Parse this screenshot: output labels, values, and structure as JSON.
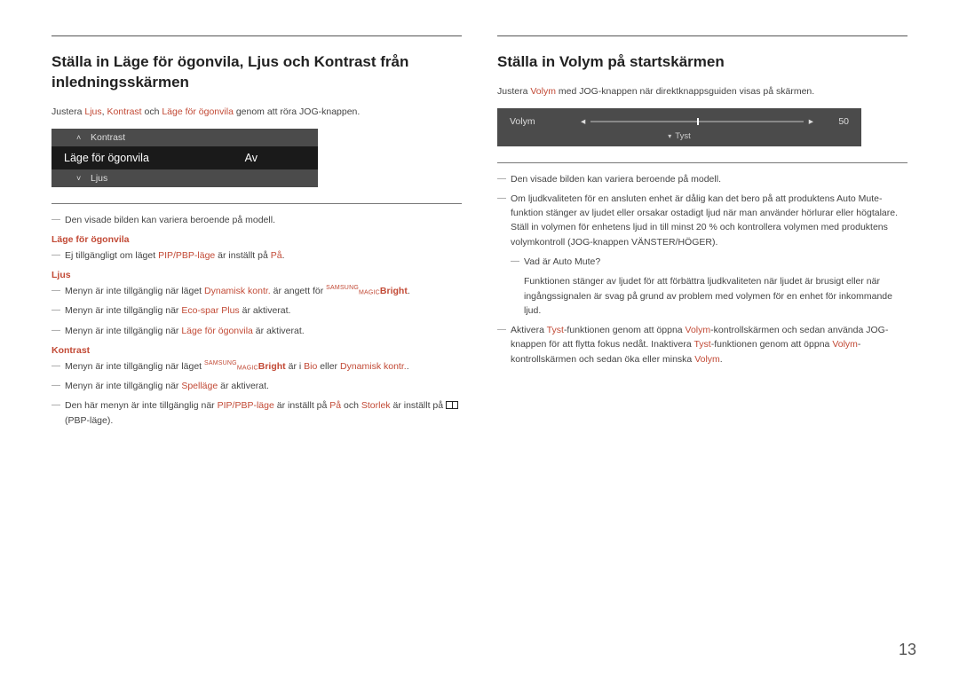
{
  "page_number": "13",
  "left": {
    "heading": "Ställa in Läge för ögonvila, Ljus och Kontrast från inledningsskärmen",
    "intro_pre": "Justera ",
    "intro_terms": [
      "Ljus",
      "Kontrast",
      "Läge för ögonvila"
    ],
    "intro_post": " genom att röra JOG-knappen.",
    "osd": {
      "top_label": "Kontrast",
      "sel_label": "Läge för ögonvila",
      "sel_value": "Av",
      "bottom_label": "Ljus"
    },
    "notes": {
      "model_vary": "Den visade bilden kan variera beroende på modell.",
      "sh1": "Läge för ögonvila",
      "n1_pre": "Ej tillgängligt om läget ",
      "n1_hl1": "PIP/PBP-läge",
      "n1_mid": " är inställt på ",
      "n1_hl2": "På",
      "n1_post": ".",
      "sh2": "Ljus",
      "n2_pre": "Menyn är inte tillgänglig när läget ",
      "n2_hl": "Dynamisk kontr.",
      "n2_mid": " är angett för ",
      "n2_brand": "Bright",
      "n2_post": ".",
      "n3_pre": "Menyn är inte tillgänglig när ",
      "n3_hl": "Eco-spar Plus",
      "n3_post": " är aktiverat.",
      "n4_pre": "Menyn är inte tillgänglig när ",
      "n4_hl": "Läge för ögonvila",
      "n4_post": " är aktiverat.",
      "sh3": "Kontrast",
      "n5_pre": "Menyn är inte tillgänglig när läget ",
      "n5_brand": "Bright",
      "n5_mid": " är i ",
      "n5_hl1": "Bio",
      "n5_or": " eller ",
      "n5_hl2": "Dynamisk kontr.",
      "n5_post": ".",
      "n6_pre": "Menyn är inte tillgänglig när ",
      "n6_hl": "Spelläge",
      "n6_post": " är aktiverat.",
      "n7_pre": "Den här menyn är inte tillgänglig när ",
      "n7_hl1": "PIP/PBP-läge",
      "n7_mid1": " är inställt på ",
      "n7_hl2": "På",
      "n7_mid2": " och ",
      "n7_hl3": "Storlek",
      "n7_mid3": " är inställt på ",
      "n7_post": " (PBP-läge)."
    }
  },
  "right": {
    "heading": "Ställa in Volym på startskärmen",
    "intro_pre": "Justera ",
    "intro_hl": "Volym",
    "intro_post": " med JOG-knappen när direktknappsguiden visas på skärmen.",
    "osd": {
      "label": "Volym",
      "value": "50",
      "below": "Tyst"
    },
    "notes": {
      "model_vary": "Den visade bilden kan variera beroende på modell.",
      "n1": "Om ljudkvaliteten för en ansluten enhet är dålig kan det bero på att produktens Auto Mute-funktion stänger av ljudet eller orsakar ostadigt ljud när man använder hörlurar eller högtalare. Ställ in volymen för enhetens ljud in till minst 20 % och kontrollera volymen med produktens volymkontroll (JOG-knappen VÄNSTER/HÖGER).",
      "q": "Vad är Auto Mute?",
      "qdesc": "Funktionen stänger av ljudet för att förbättra ljudkvaliteten när ljudet är brusigt eller när ingångssignalen är svag på grund av problem med volymen för en enhet för inkommande ljud.",
      "n2_pre": "Aktivera ",
      "n2_hl1": "Tyst",
      "n2_p1": "-funktionen genom att öppna ",
      "n2_hl2": "Volym",
      "n2_p2": "-kontrollskärmen och sedan använda JOG-knappen för att flytta fokus nedåt. Inaktivera ",
      "n2_hl3": "Tyst",
      "n2_p3": "-funktionen genom att öppna ",
      "n2_hl4": "Volym",
      "n2_p4": "-kontrollskärmen och sedan öka eller minska ",
      "n2_hl5": "Volym",
      "n2_p5": "."
    }
  }
}
